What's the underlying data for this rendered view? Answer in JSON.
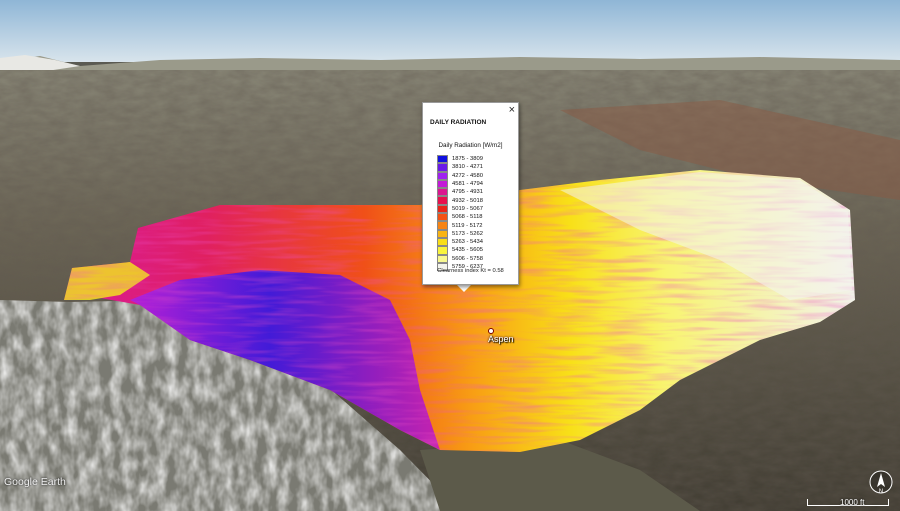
{
  "map": {
    "place_label": "Aspen",
    "attribution": "Google Earth",
    "scale_label": "1000 ft",
    "compass_letter": "N"
  },
  "popup": {
    "close_symbol": "×",
    "title": "DAILY RADIATION",
    "legend_heading": "Daily Radiation [W/m2]",
    "legend": [
      {
        "label": "1875 - 3809",
        "color": "#1010e0"
      },
      {
        "label": "3810 - 4271",
        "color": "#6a1ae8"
      },
      {
        "label": "4272 - 4580",
        "color": "#a020f0"
      },
      {
        "label": "4581 - 4794",
        "color": "#c31ad8"
      },
      {
        "label": "4795 - 4931",
        "color": "#dc1690"
      },
      {
        "label": "4932 - 5018",
        "color": "#e8104e"
      },
      {
        "label": "5019 - 5067",
        "color": "#ea2418"
      },
      {
        "label": "5068 - 5118",
        "color": "#f45214"
      },
      {
        "label": "5119 - 5172",
        "color": "#f78414"
      },
      {
        "label": "5173 - 5262",
        "color": "#f8b414"
      },
      {
        "label": "5263 - 5434",
        "color": "#f8de18"
      },
      {
        "label": "5435 - 5605",
        "color": "#f8f43c"
      },
      {
        "label": "5606 - 5758",
        "color": "#f8f890"
      },
      {
        "label": "5759 - 6237",
        "color": "#f4f4ec"
      }
    ],
    "clearness": "Clearness index Kt = 0.58"
  }
}
